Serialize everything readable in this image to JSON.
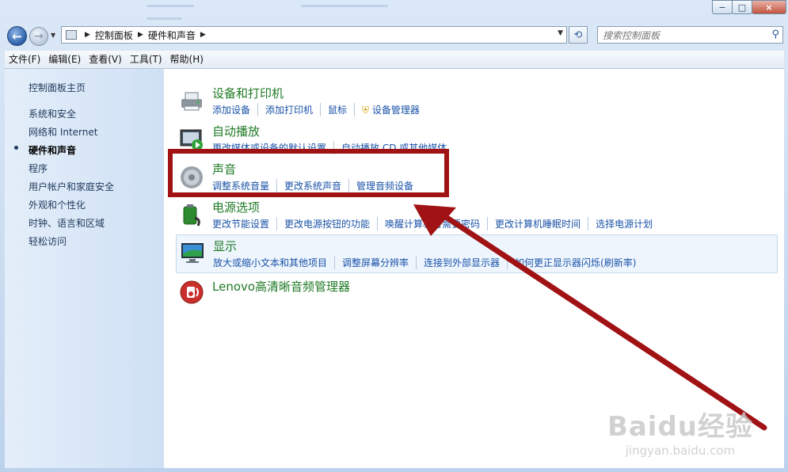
{
  "window": {
    "minimize": "−",
    "maximize": "□",
    "close": "×"
  },
  "nav": {
    "back_icon": "arrow-left",
    "forward_icon": "arrow-right",
    "breadcrumb": [
      "控制面板",
      "硬件和声音"
    ],
    "search_placeholder": "搜索控制面板"
  },
  "menu": [
    "文件(F)",
    "编辑(E)",
    "查看(V)",
    "工具(T)",
    "帮助(H)"
  ],
  "sidebar": {
    "items": [
      {
        "label": "控制面板主页",
        "active": false
      },
      {
        "label": "系统和安全",
        "active": false
      },
      {
        "label": "网络和 Internet",
        "active": false
      },
      {
        "label": "硬件和声音",
        "active": true
      },
      {
        "label": "程序",
        "active": false
      },
      {
        "label": "用户帐户和家庭安全",
        "active": false
      },
      {
        "label": "外观和个性化",
        "active": false
      },
      {
        "label": "时钟、语言和区域",
        "active": false
      },
      {
        "label": "轻松访问",
        "active": false
      }
    ]
  },
  "categories": [
    {
      "title": "设备和打印机",
      "icon": "printer-icon",
      "links": [
        "添加设备",
        "添加打印机",
        "鼠标",
        "设备管理器"
      ]
    },
    {
      "title": "自动播放",
      "icon": "autoplay-icon",
      "links": [
        "更改媒体或设备的默认设置",
        "自动播放 CD 或其他媒体"
      ]
    },
    {
      "title": "声音",
      "icon": "speaker-icon",
      "links": [
        "调整系统音量",
        "更改系统声音",
        "管理音频设备"
      ]
    },
    {
      "title": "电源选项",
      "icon": "battery-icon",
      "links": [
        "更改节能设置",
        "更改电源按钮的功能",
        "唤醒计算机时需要密码",
        "更改计算机睡眠时间",
        "选择电源计划"
      ]
    },
    {
      "title": "显示",
      "icon": "display-icon",
      "links": [
        "放大或缩小文本和其他项目",
        "调整屏幕分辨率",
        "连接到外部显示器",
        "如何更正显示器闪烁(刷新率)"
      ]
    },
    {
      "title": "Lenovo高清晰音频管理器",
      "icon": "lenovo-audio-icon",
      "links": []
    }
  ],
  "watermark": {
    "brand": "Baidu经验",
    "url": "jingyan.baidu.com"
  },
  "colors": {
    "category_title": "#1f7a25",
    "link": "#1a53a8",
    "annotation": "#a01214"
  }
}
